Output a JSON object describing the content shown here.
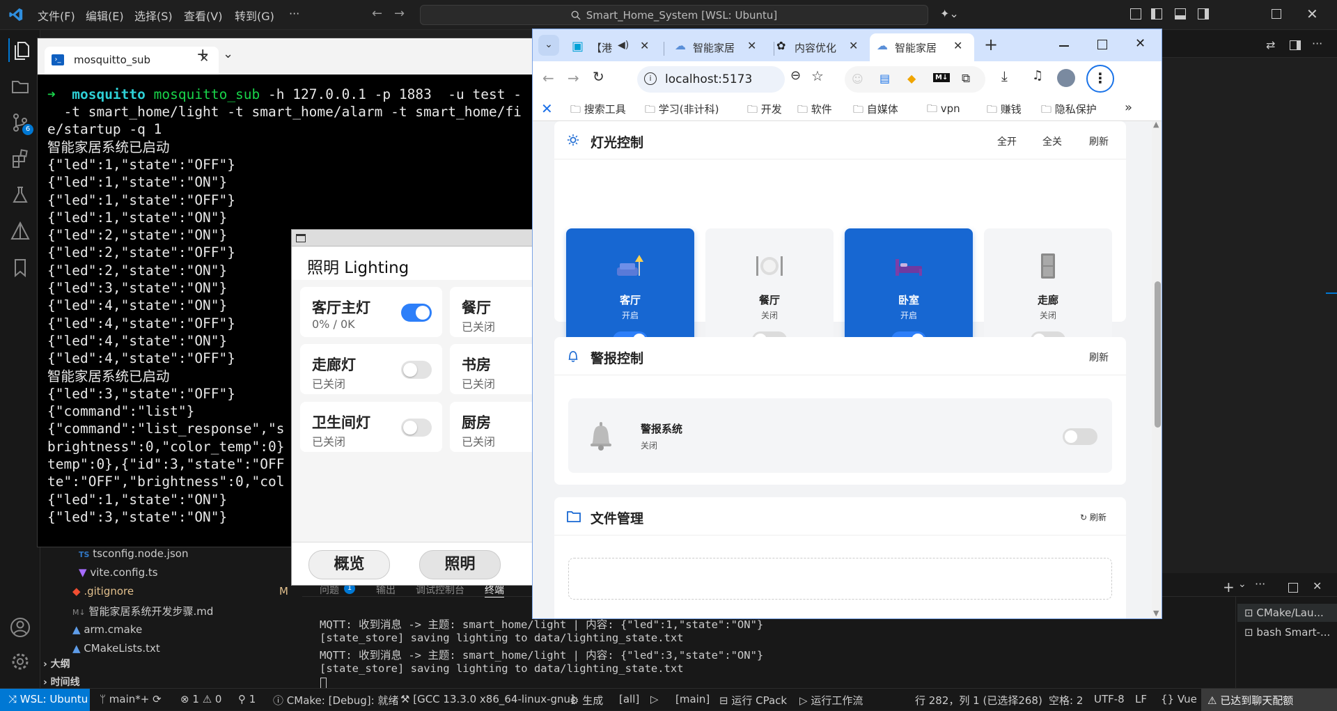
{
  "vscode": {
    "menu": [
      "文件(F)",
      "编辑(E)",
      "选择(S)",
      "查看(V)",
      "转到(G)",
      "···"
    ],
    "command_center": "Smart_Home_System [WSL: Ubuntu]",
    "source_control_badge": "6"
  },
  "explorer": {
    "files": [
      {
        "name": "tsconfig.node.json",
        "icon": "ts-icon",
        "status": ""
      },
      {
        "name": "vite.config.ts",
        "icon": "vite-icon",
        "status": ""
      },
      {
        "name": ".gitignore",
        "icon": "git-icon",
        "status": "M"
      },
      {
        "name": "智能家居系统开发步骤.md",
        "icon": "md-icon",
        "status": ""
      },
      {
        "name": "arm.cmake",
        "icon": "cmake-icon",
        "status": ""
      },
      {
        "name": "CMakeLists.txt",
        "icon": "cmake-icon",
        "status": ""
      }
    ],
    "sections": [
      "大纲",
      "时间线"
    ]
  },
  "panel": {
    "tabs": [
      "问题",
      "输出",
      "调试控制台",
      "终端"
    ],
    "problems_badge": "1",
    "lines": [
      "MQTT: 收到消息 -> 主题: smart_home/light | 内容: {\"led\":1,\"state\":\"ON\"}",
      "[state_store] saving lighting to data/lighting_state.txt",
      "MQTT: 收到消息 -> 主题: smart_home/light | 内容: {\"led\":3,\"state\":\"ON\"}",
      "[state_store] saving lighting to data/lighting_state.txt"
    ],
    "terminals": [
      "CMake/Lau...",
      "bash Smart-..."
    ]
  },
  "terminal": {
    "tab_title": "mosquitto_sub",
    "prompt_arrow": "➜",
    "prompt_dir": "mosquitto",
    "prompt_cmd": "mosquitto_sub",
    "prompt_args": " -h 127.0.0.1 -p 1883  -u test -",
    "lines": [
      "  -t smart_home/light -t smart_home/alarm -t smart_home/fi",
      "e/startup -q 1",
      "智能家居系统已启动",
      "{\"led\":1,\"state\":\"OFF\"}",
      "{\"led\":1,\"state\":\"ON\"}",
      "{\"led\":1,\"state\":\"OFF\"}",
      "{\"led\":1,\"state\":\"ON\"}",
      "{\"led\":2,\"state\":\"ON\"}",
      "{\"led\":2,\"state\":\"OFF\"}",
      "{\"led\":2,\"state\":\"ON\"}",
      "{\"led\":3,\"state\":\"ON\"}",
      "{\"led\":4,\"state\":\"ON\"}",
      "{\"led\":4,\"state\":\"OFF\"}",
      "{\"led\":4,\"state\":\"ON\"}",
      "{\"led\":4,\"state\":\"OFF\"}",
      "智能家居系统已启动",
      "{\"led\":3,\"state\":\"OFF\"}",
      "{\"command\":\"list\"}",
      "{\"command\":\"list_response\",\"s",
      "brightness\":0,\"color_temp\":0}",
      "temp\":0},{\"id\":3,\"state\":\"OFF",
      "te\":\"OFF\",\"brightness\":0,\"col",
      "{\"led\":1,\"state\":\"ON\"}",
      "{\"led\":3,\"state\":\"ON\"}"
    ]
  },
  "qt_app": {
    "title": "照明 Lighting",
    "cards": [
      {
        "name": "客厅主灯",
        "status": "0% / 0K",
        "on": true
      },
      {
        "name": "餐厅",
        "status": "已关闭",
        "on": false
      },
      {
        "name": "走廊灯",
        "status": "已关闭",
        "on": false
      },
      {
        "name": "书房",
        "status": "已关闭",
        "on": false
      },
      {
        "name": "卫生间灯",
        "status": "已关闭",
        "on": false
      },
      {
        "name": "厨房",
        "status": "已关闭",
        "on": false
      }
    ],
    "nav": [
      "概览",
      "照明"
    ]
  },
  "chrome": {
    "tabs": [
      {
        "title": "【港",
        "icon": "bilibili-icon"
      },
      {
        "title": "智能家居",
        "icon": "cloud-icon"
      },
      {
        "title": "内容优化",
        "icon": "openai-icon"
      },
      {
        "title": "智能家居",
        "icon": "cloud-icon",
        "active": true
      }
    ],
    "url": "localhost:5173",
    "bookmarks": [
      "搜索工具",
      "学习(非计科)",
      "开发",
      "软件",
      "自媒体",
      "vpn",
      "赚钱",
      "隐私保护"
    ]
  },
  "web": {
    "lighting": {
      "title": "灯光控制",
      "actions": [
        "全开",
        "全关",
        "刷新"
      ],
      "rooms": [
        {
          "name": "客厅",
          "status": "开启",
          "on": true,
          "icon": "sofa-lamp-icon"
        },
        {
          "name": "餐厅",
          "status": "关闭",
          "on": false,
          "icon": "dining-icon"
        },
        {
          "name": "卧室",
          "status": "开启",
          "on": true,
          "icon": "bed-icon"
        },
        {
          "name": "走廊",
          "status": "关闭",
          "on": false,
          "icon": "door-icon"
        }
      ]
    },
    "alarm": {
      "title": "警报控制",
      "refresh": "刷新",
      "system_name": "警报系统",
      "system_status": "关闭",
      "on": false
    },
    "files": {
      "title": "文件管理",
      "refresh": "刷新"
    }
  },
  "statusbar": {
    "remote": "WSL: Ubuntu",
    "branch": "main*+",
    "errors": "1",
    "warnings": "0",
    "ports": "1",
    "cmake": "CMake: [Debug]: 就绪",
    "kit": "[GCC 13.3.0 x86_64-linux-gnu]",
    "build": "生成",
    "target": "[all]",
    "launch": "[main]",
    "cpack": "运行 CPack",
    "workflow": "运行工作流",
    "cursor": "行 282，列 1 (已选择268)",
    "spaces": "空格: 2",
    "encoding": "UTF-8",
    "eol": "LF",
    "lang": "Vue",
    "copilot": "已达到聊天配额"
  },
  "colors": {
    "accent": "#1767d2",
    "vscode_blue": "#0078d4",
    "toggle_on": "#2d7ff9"
  }
}
